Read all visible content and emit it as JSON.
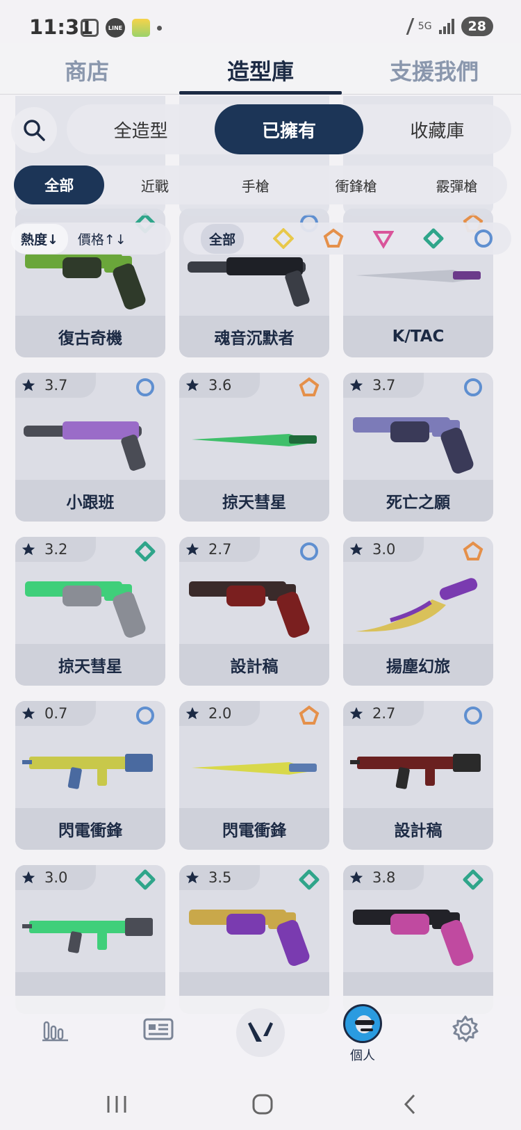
{
  "status_bar": {
    "time": "11:31",
    "line_badge": "LINE",
    "network": "5G",
    "battery": "28"
  },
  "top_tabs": [
    {
      "label": "商店",
      "active": false
    },
    {
      "label": "造型庫",
      "active": true
    },
    {
      "label": "支援我們",
      "active": false
    }
  ],
  "scope_tabs": [
    {
      "label": "全造型",
      "active": false
    },
    {
      "label": "已擁有",
      "active": true
    },
    {
      "label": "收藏庫",
      "active": false
    }
  ],
  "category_chips": [
    {
      "label": "全部",
      "active": true
    },
    {
      "label": "近戰",
      "active": false
    },
    {
      "label": "手槍",
      "active": false
    },
    {
      "label": "衝鋒槍",
      "active": false
    },
    {
      "label": "霰彈槍",
      "active": false
    }
  ],
  "sort": {
    "popularity": "熱度↓",
    "price": "價格↑↓"
  },
  "tier_filter": {
    "all_label": "全部",
    "tiers": [
      {
        "name": "select-tier-icon",
        "color": "#e8c84a"
      },
      {
        "name": "exclusive-tier-icon",
        "color": "#e5904a"
      },
      {
        "name": "premium-tier-icon",
        "color": "#d9549a"
      },
      {
        "name": "deluxe-tier-icon",
        "color": "#2fa58a"
      },
      {
        "name": "standard-tier-icon",
        "color": "#5f8fd0"
      }
    ]
  },
  "skins": [
    {
      "name": "復古奇機",
      "rating": "",
      "tier": "deluxe",
      "weapon": "revolver-icon",
      "colors": [
        "#6aa63a",
        "#2f3a2a"
      ]
    },
    {
      "name": "魂音沉默者",
      "rating": "",
      "tier": "standard",
      "weapon": "suppressed-pistol-icon",
      "colors": [
        "#3a3d45",
        "#1e2026"
      ]
    },
    {
      "name": "K/TAC",
      "rating": "",
      "tier": "exclusive",
      "weapon": "knife-icon",
      "colors": [
        "#bfc2cc",
        "#6b3a8a"
      ]
    },
    {
      "name": "小跟班",
      "rating": "3.7",
      "tier": "standard",
      "weapon": "shotgun-pistol-icon",
      "colors": [
        "#4a4c55",
        "#9a6cc8"
      ]
    },
    {
      "name": "掠天彗星",
      "rating": "3.6",
      "tier": "exclusive",
      "weapon": "knife-icon",
      "colors": [
        "#3fbf6a",
        "#1f6a3a"
      ]
    },
    {
      "name": "死亡之願",
      "rating": "3.7",
      "tier": "standard",
      "weapon": "revolver-icon",
      "colors": [
        "#7c7bb8",
        "#3a3a58"
      ]
    },
    {
      "name": "掠天彗星",
      "rating": "3.2",
      "tier": "deluxe",
      "weapon": "pistol-icon",
      "colors": [
        "#3fcf7a",
        "#8a8d95"
      ]
    },
    {
      "name": "設計稿",
      "rating": "2.7",
      "tier": "standard",
      "weapon": "revolver-icon",
      "colors": [
        "#3a2a2a",
        "#7a1f1f"
      ]
    },
    {
      "name": "揚塵幻旅",
      "rating": "3.0",
      "tier": "exclusive",
      "weapon": "curved-knife-icon",
      "colors": [
        "#d9c15a",
        "#7a3bb0"
      ]
    },
    {
      "name": "閃電衝鋒",
      "rating": "0.7",
      "tier": "standard",
      "weapon": "smg-icon",
      "colors": [
        "#c8c84a",
        "#4a6aa0"
      ]
    },
    {
      "name": "閃電衝鋒",
      "rating": "2.0",
      "tier": "exclusive",
      "weapon": "knife-icon",
      "colors": [
        "#d8d84a",
        "#5a7ab0"
      ]
    },
    {
      "name": "設計稿",
      "rating": "2.7",
      "tier": "standard",
      "weapon": "rifle-icon",
      "colors": [
        "#6a2020",
        "#2a2a2a"
      ]
    },
    {
      "name": "",
      "rating": "3.0",
      "tier": "deluxe",
      "weapon": "rifle-icon",
      "colors": [
        "#3fcf7a",
        "#4a4c55"
      ]
    },
    {
      "name": "",
      "rating": "3.5",
      "tier": "deluxe",
      "weapon": "revolver-icon",
      "colors": [
        "#c9a84a",
        "#7a3bb0"
      ]
    },
    {
      "name": "",
      "rating": "3.8",
      "tier": "deluxe",
      "weapon": "revolver-icon",
      "colors": [
        "#222228",
        "#c04aa0"
      ]
    }
  ],
  "bottom_nav": {
    "profile_label": "個人"
  }
}
